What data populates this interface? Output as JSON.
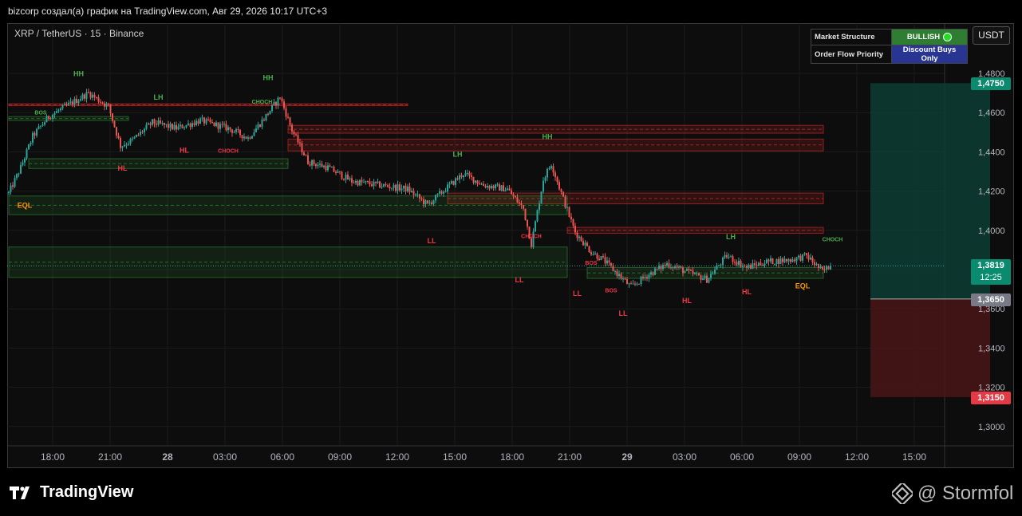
{
  "header": {
    "text": "bizcorp создал(а) график на TradingView.com, Авг 29, 2026 10:17 UTC+3"
  },
  "symbol": {
    "text": "XRP / TetherUS · 15 · Binance"
  },
  "currency": {
    "label": "USDT"
  },
  "status_table": {
    "market_structure_label": "Market Structure",
    "market_structure_value": "BULLISH",
    "order_flow_label": "Order Flow Priority",
    "order_flow_value": "Discount Buys Only"
  },
  "price_labels": {
    "take_profit": "1,4750",
    "current_price": "1,3819",
    "countdown": "12:25",
    "entry": "1,3650",
    "stop_loss": "1,3150"
  },
  "branding": {
    "logo": "TradingView",
    "watermark": "@ Stormfol"
  },
  "colors": {
    "up": "#26a69a",
    "down": "#ef5350",
    "bullish_label": "#4caf50",
    "bearish_label": "#f23645",
    "eq_label": "#ff9800",
    "profit_zone": "#0c3d34",
    "loss_zone": "#4a1518"
  },
  "chart_data": {
    "type": "candlestick",
    "y_axis": {
      "ticks": [
        "1,4800",
        "1,4600",
        "1,4400",
        "1,4200",
        "1,4000",
        "1,3800",
        "1,3600",
        "1,3400",
        "1,3200",
        "1,3000"
      ],
      "tick_values": [
        1.48,
        1.46,
        1.44,
        1.42,
        1.4,
        1.38,
        1.36,
        1.34,
        1.32,
        1.3
      ]
    },
    "x_axis": {
      "ticks": [
        "18:00",
        "21:00",
        "28",
        "03:00",
        "06:00",
        "09:00",
        "12:00",
        "15:00",
        "18:00",
        "21:00",
        "29",
        "03:00",
        "06:00",
        "09:00",
        "12:00",
        "15:00"
      ]
    },
    "anchors": [
      {
        "i": 0,
        "p": 1.419
      },
      {
        "i": 6,
        "p": 1.432
      },
      {
        "i": 12,
        "p": 1.448
      },
      {
        "i": 20,
        "p": 1.458
      },
      {
        "i": 30,
        "p": 1.464
      },
      {
        "i": 40,
        "p": 1.47
      },
      {
        "i": 50,
        "p": 1.463
      },
      {
        "i": 56,
        "p": 1.443
      },
      {
        "i": 62,
        "p": 1.446
      },
      {
        "i": 72,
        "p": 1.455
      },
      {
        "i": 84,
        "p": 1.452
      },
      {
        "i": 96,
        "p": 1.456
      },
      {
        "i": 110,
        "p": 1.452
      },
      {
        "i": 120,
        "p": 1.447
      },
      {
        "i": 128,
        "p": 1.457
      },
      {
        "i": 136,
        "p": 1.468
      },
      {
        "i": 142,
        "p": 1.451
      },
      {
        "i": 150,
        "p": 1.435
      },
      {
        "i": 160,
        "p": 1.432
      },
      {
        "i": 172,
        "p": 1.425
      },
      {
        "i": 186,
        "p": 1.423
      },
      {
        "i": 200,
        "p": 1.421
      },
      {
        "i": 210,
        "p": 1.413
      },
      {
        "i": 220,
        "p": 1.422
      },
      {
        "i": 228,
        "p": 1.429
      },
      {
        "i": 238,
        "p": 1.423
      },
      {
        "i": 250,
        "p": 1.421
      },
      {
        "i": 258,
        "p": 1.411
      },
      {
        "i": 262,
        "p": 1.393
      },
      {
        "i": 268,
        "p": 1.426
      },
      {
        "i": 272,
        "p": 1.434
      },
      {
        "i": 278,
        "p": 1.416
      },
      {
        "i": 284,
        "p": 1.399
      },
      {
        "i": 292,
        "p": 1.389
      },
      {
        "i": 298,
        "p": 1.385
      },
      {
        "i": 306,
        "p": 1.377
      },
      {
        "i": 312,
        "p": 1.371
      },
      {
        "i": 320,
        "p": 1.377
      },
      {
        "i": 330,
        "p": 1.383
      },
      {
        "i": 342,
        "p": 1.378
      },
      {
        "i": 350,
        "p": 1.375
      },
      {
        "i": 360,
        "p": 1.387
      },
      {
        "i": 370,
        "p": 1.381
      },
      {
        "i": 380,
        "p": 1.384
      },
      {
        "i": 392,
        "p": 1.385
      },
      {
        "i": 400,
        "p": 1.387
      },
      {
        "i": 408,
        "p": 1.379
      },
      {
        "i": 412,
        "p": 1.3819
      }
    ],
    "n_candles": 413,
    "zones": [
      {
        "kind": "supply",
        "top": 1.4645,
        "bottom": 1.4635,
        "from_i": 0,
        "to_i": 200
      },
      {
        "kind": "supply",
        "top": 1.4535,
        "bottom": 1.4495,
        "from_i": 140,
        "to_i": 413
      },
      {
        "kind": "supply",
        "top": 1.4465,
        "bottom": 1.4405,
        "from_i": 140,
        "to_i": 413
      },
      {
        "kind": "supply",
        "top": 1.419,
        "bottom": 1.4135,
        "from_i": 220,
        "to_i": 413
      },
      {
        "kind": "supply",
        "top": 1.4015,
        "bottom": 1.3985,
        "from_i": 280,
        "to_i": 413
      },
      {
        "kind": "demand",
        "top": 1.458,
        "bottom": 1.456,
        "from_i": 0,
        "to_i": 60
      },
      {
        "kind": "demand",
        "top": 1.4365,
        "bottom": 1.4315,
        "from_i": 10,
        "to_i": 140
      },
      {
        "kind": "demand",
        "top": 1.4175,
        "bottom": 1.408,
        "from_i": 0,
        "to_i": 280
      },
      {
        "kind": "demand",
        "top": 1.3915,
        "bottom": 1.376,
        "from_i": 0,
        "to_i": 280
      },
      {
        "kind": "demand",
        "top": 1.381,
        "bottom": 1.3755,
        "from_i": 290,
        "to_i": 413
      }
    ],
    "annotations": [
      {
        "text": "HH",
        "i": 35,
        "p": 1.4785,
        "kind": "bull"
      },
      {
        "text": "LH",
        "i": 75,
        "p": 1.4665,
        "kind": "bull"
      },
      {
        "text": "HH",
        "i": 130,
        "p": 1.4765,
        "kind": "bull"
      },
      {
        "text": "HH",
        "i": 270,
        "p": 1.4465,
        "kind": "bull"
      },
      {
        "text": "LH",
        "i": 225,
        "p": 1.4375,
        "kind": "bull"
      },
      {
        "text": "LH",
        "i": 362,
        "p": 1.3955,
        "kind": "bull"
      },
      {
        "text": "HL",
        "i": 57,
        "p": 1.4305,
        "kind": "bear"
      },
      {
        "text": "HL",
        "i": 88,
        "p": 1.4395,
        "kind": "bear"
      },
      {
        "text": "LL",
        "i": 212,
        "p": 1.3935,
        "kind": "bear"
      },
      {
        "text": "LL",
        "i": 256,
        "p": 1.3735,
        "kind": "bear"
      },
      {
        "text": "LL",
        "i": 285,
        "p": 1.3665,
        "kind": "bear"
      },
      {
        "text": "LL",
        "i": 308,
        "p": 1.3565,
        "kind": "bear"
      },
      {
        "text": "HL",
        "i": 340,
        "p": 1.363,
        "kind": "bear"
      },
      {
        "text": "HL",
        "i": 370,
        "p": 1.3675,
        "kind": "bear"
      },
      {
        "text": "EQL",
        "i": 8,
        "p": 1.4115,
        "kind": "eq"
      },
      {
        "text": "EQL",
        "i": 398,
        "p": 1.3705,
        "kind": "eq"
      },
      {
        "text": "CHOCH",
        "i": 127,
        "p": 1.4645,
        "kind": "bull-small"
      },
      {
        "text": "CHOCH",
        "i": 413,
        "p": 1.3945,
        "kind": "bull-small"
      },
      {
        "text": "CHOCH",
        "i": 110,
        "p": 1.4395,
        "kind": "bear-small"
      },
      {
        "text": "CHOCH",
        "i": 262,
        "p": 1.396,
        "kind": "bear-small"
      },
      {
        "text": "BOS",
        "i": 16,
        "p": 1.459,
        "kind": "bull-small"
      },
      {
        "text": "BOS",
        "i": 292,
        "p": 1.3825,
        "kind": "bear-small"
      },
      {
        "text": "BOS",
        "i": 302,
        "p": 1.3685,
        "kind": "bear-small"
      }
    ],
    "position": {
      "entry": 1.365,
      "take_profit": 1.475,
      "stop_loss": 1.315,
      "from_i": 432,
      "to_i": 492
    },
    "current_price": 1.3819
  }
}
